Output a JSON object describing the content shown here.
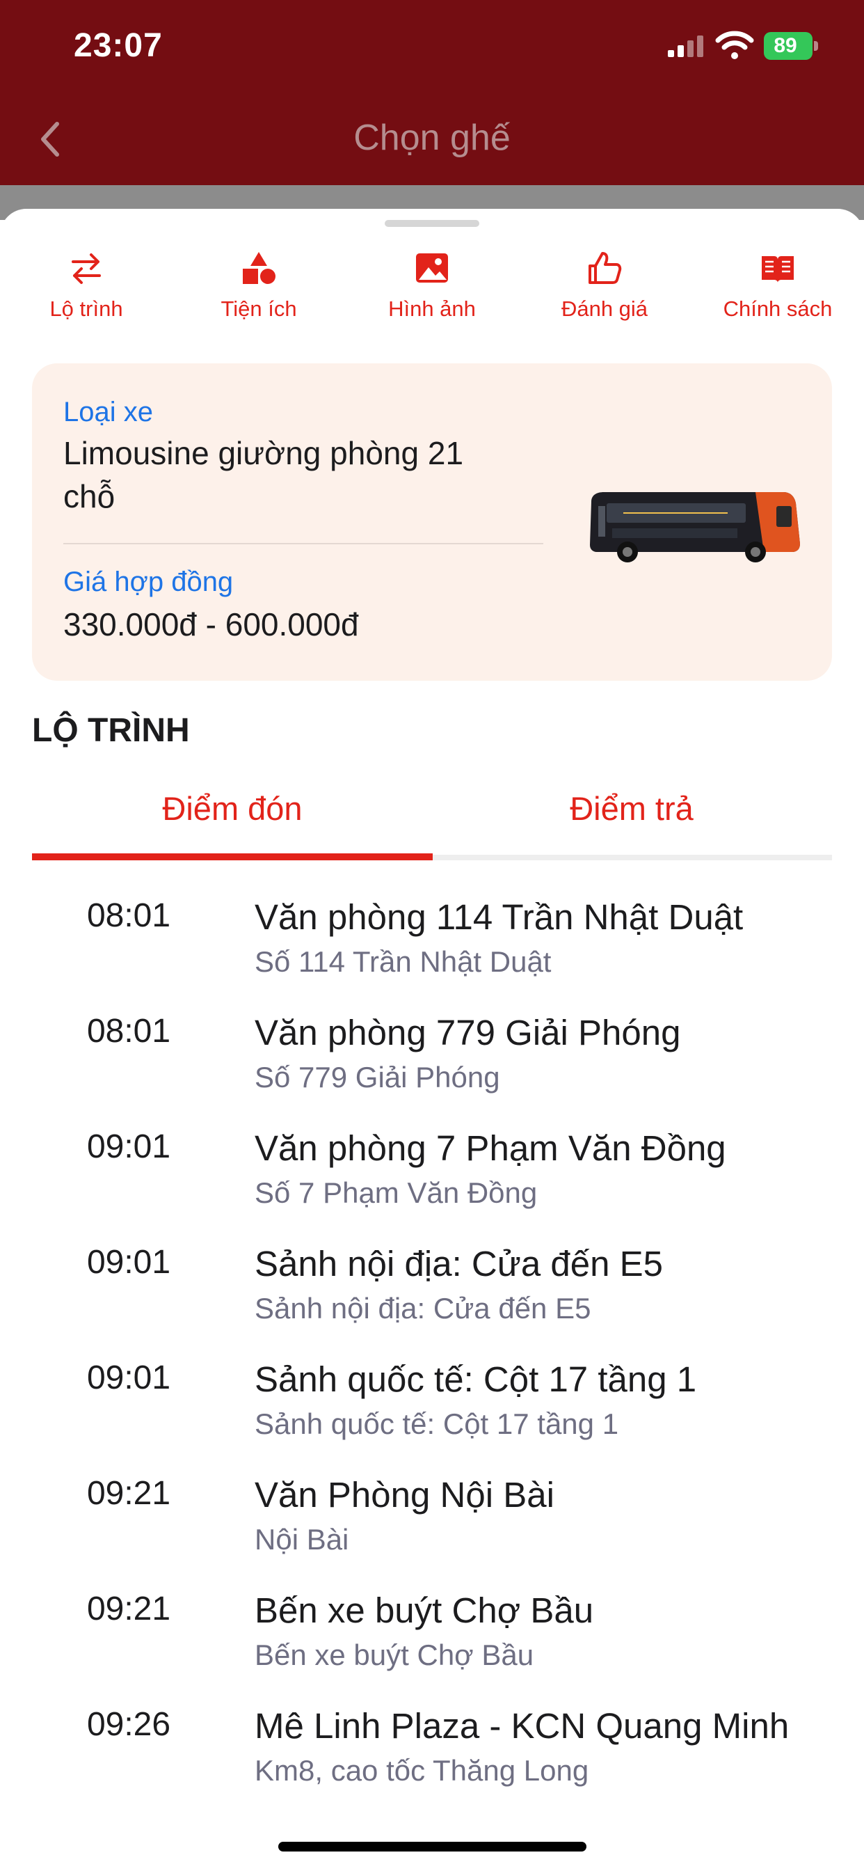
{
  "status": {
    "time": "23:07",
    "battery": "89"
  },
  "nav": {
    "title": "Chọn ghế"
  },
  "icon_tabs": [
    {
      "label": "Lộ trình",
      "icon": "swap-arrows-icon"
    },
    {
      "label": "Tiện ích",
      "icon": "shapes-icon"
    },
    {
      "label": "Hình ảnh",
      "icon": "image-icon"
    },
    {
      "label": "Đánh giá",
      "icon": "thumbs-up-icon"
    },
    {
      "label": "Chính sách",
      "icon": "book-icon"
    }
  ],
  "vehicle": {
    "type_label": "Loại xe",
    "type_value_line1": "Limousine giường phòng 21",
    "type_value_line2": "chỗ",
    "price_label": "Giá hợp đồng",
    "price_value": "330.000đ - 600.000đ"
  },
  "route": {
    "title": "LỘ TRÌNH",
    "tab_pickup": "Điểm đón",
    "tab_dropoff": "Điểm trả",
    "active_tab": "pickup",
    "stops": [
      {
        "time": "08:01",
        "name": "Văn phòng 114 Trần Nhật Duật",
        "address": "Số 114 Trần Nhật Duật"
      },
      {
        "time": "08:01",
        "name": "Văn phòng 779 Giải Phóng",
        "address": "Số 779 Giải Phóng"
      },
      {
        "time": "09:01",
        "name": "Văn phòng 7 Phạm Văn Đồng",
        "address": "Số 7 Phạm Văn Đồng"
      },
      {
        "time": "09:01",
        "name": "Sảnh nội địa: Cửa đến E5",
        "address": "Sảnh nội địa: Cửa đến E5"
      },
      {
        "time": "09:01",
        "name": "Sảnh quốc tế: Cột 17 tầng 1",
        "address": "Sảnh quốc tế: Cột 17 tầng 1"
      },
      {
        "time": "09:21",
        "name": "Văn Phòng Nội Bài",
        "address": "Nội Bài"
      },
      {
        "time": "09:21",
        "name": "Bến xe buýt Chợ Bầu",
        "address": "Bến xe buýt Chợ Bầu"
      },
      {
        "time": "09:26",
        "name": "Mê Linh Plaza - KCN Quang Minh",
        "address": "Km8, cao tốc Thăng Long"
      }
    ]
  },
  "colors": {
    "accent": "#e2231a",
    "header": "#740d12",
    "link_blue": "#1e74e6",
    "card_bg": "#fdf1ea"
  }
}
